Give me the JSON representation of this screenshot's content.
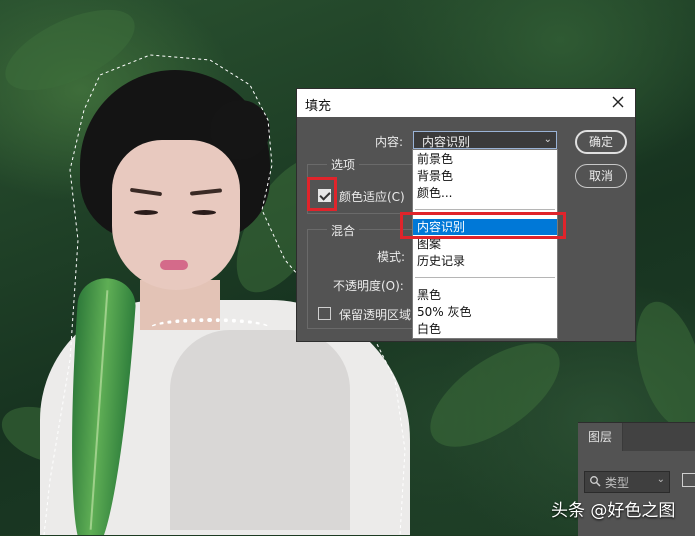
{
  "dialog": {
    "title": "填充",
    "contents_label": "内容:",
    "contents_value": "内容识别",
    "options_label": "选项",
    "color_adapt_label": "颜色适应(C)",
    "blend_label": "混合",
    "mode_label": "模式:",
    "opacity_label": "不透明度(O):",
    "preserve_label": "保留透明区域",
    "ok": "确定",
    "cancel": "取消"
  },
  "dropdown": {
    "items": [
      "前景色",
      "背景色",
      "颜色...",
      "内容识别",
      "图案",
      "历史记录",
      "黑色",
      "50% 灰色",
      "白色"
    ],
    "selected": "内容识别"
  },
  "layers_panel": {
    "tab": "图层",
    "filter_label": "类型"
  },
  "watermark": "头条 @好色之图",
  "colors": {
    "highlight": "#e0242b",
    "selection": "#0078d7",
    "panel": "#535353"
  }
}
